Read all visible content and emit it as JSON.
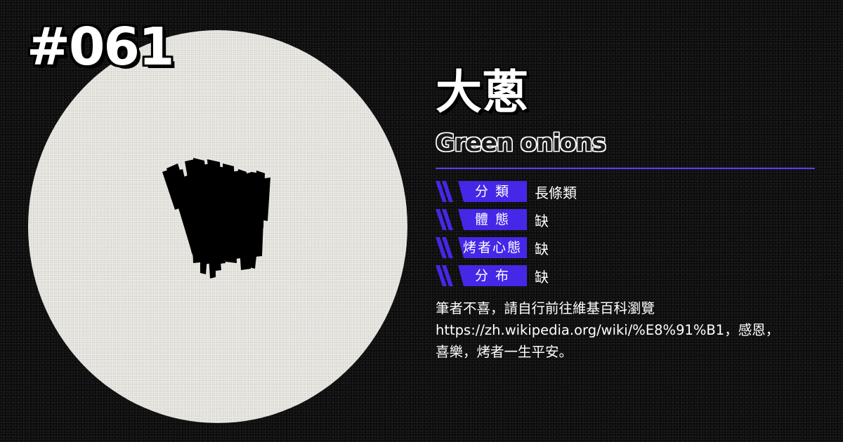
{
  "card": {
    "number": "#061",
    "title_cn": "大蔥",
    "title_en": "Green onions",
    "figure_icon": "green-onion-silhouette-icon",
    "colors": {
      "background": "#0d0d0d",
      "disc": "#f1efea",
      "accent": "#4527e8",
      "divider": "#5b3cff",
      "text": "#ffffff"
    }
  },
  "attributes": [
    {
      "label": "分 類",
      "value": "長條類"
    },
    {
      "label": "體 態",
      "value": "缺"
    },
    {
      "label": "烤者心態",
      "value": "缺"
    },
    {
      "label": "分 布",
      "value": "缺"
    }
  ],
  "description": {
    "line1": "筆者不喜，請自行前往維基百科瀏覽",
    "line2": "https://zh.wikipedia.org/wiki/%E8%91%B1，感恩，",
    "line3": "喜樂，烤者一生平安。"
  }
}
